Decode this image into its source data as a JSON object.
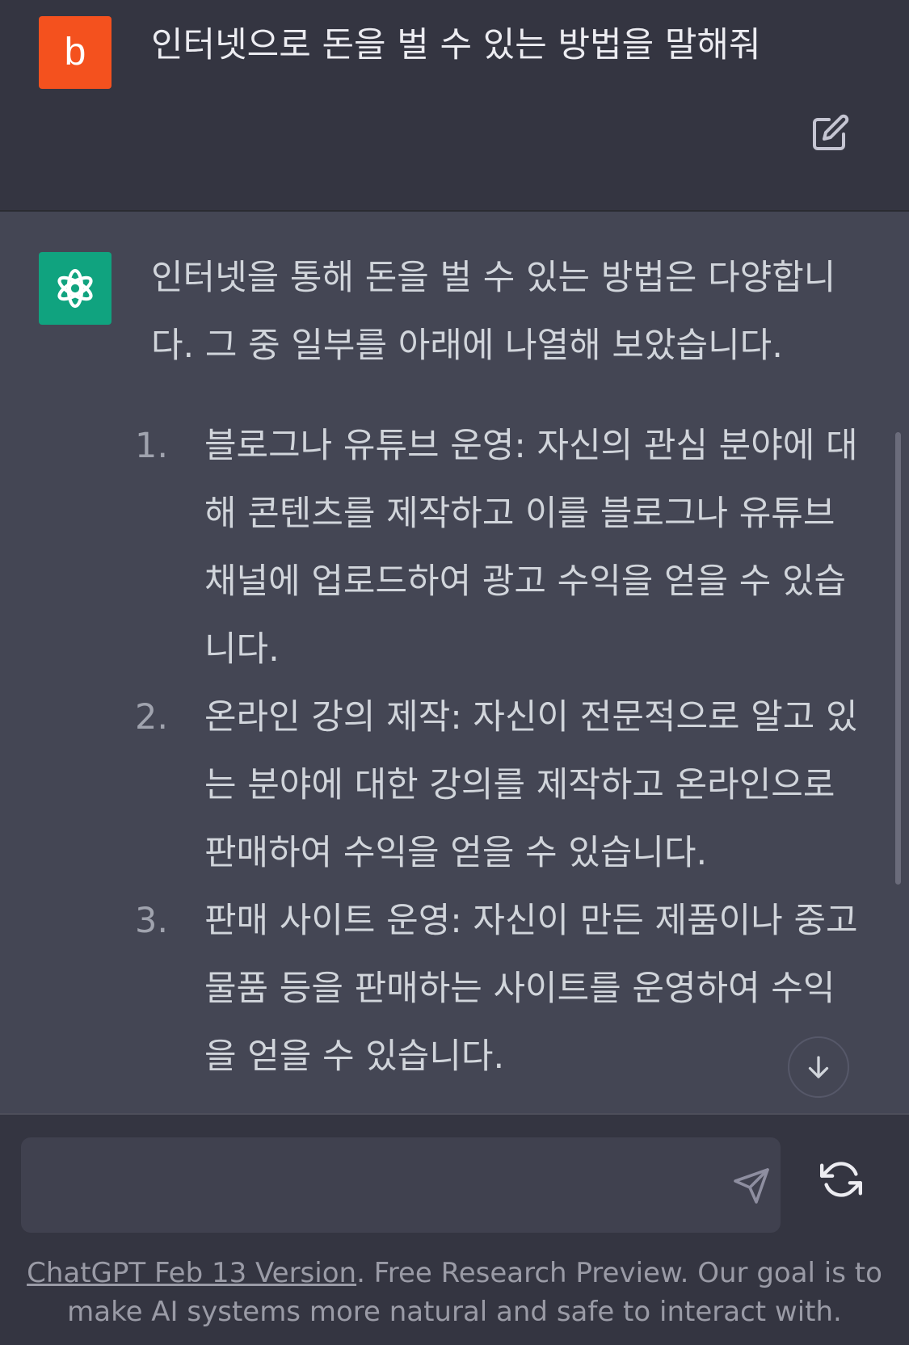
{
  "user_message": {
    "avatar_letter": "b",
    "text": "인터넷으로 돈을 벌 수 있는 방법을 말해줘"
  },
  "assistant_message": {
    "intro": "인터넷을 통해 돈을 벌 수 있는 방법은 다양합니다. 그 중 일부를 아래에 나열해 보았습니다.",
    "items": [
      {
        "number": "1.",
        "text": "블로그나 유튜브 운영: 자신의 관심 분야에 대해 콘텐츠를 제작하고 이를 블로그나 유튜브 채널에 업로드하여 광고 수익을 얻을 수 있습니다."
      },
      {
        "number": "2.",
        "text": "온라인 강의 제작: 자신이 전문적으로 알고 있는 분야에 대한 강의를 제작하고 온라인으로 판매하여 수익을 얻을 수 있습니다."
      },
      {
        "number": "3.",
        "text": "판매 사이트 운영: 자신이 만든 제품이나 중고 물품 등을 판매하는 사이트를 운영하여 수익을 얻을 수 있습니다."
      }
    ]
  },
  "composer": {
    "input_value": "",
    "input_placeholder": ""
  },
  "footer": {
    "version_link": "ChatGPT Feb 13 Version",
    "text": ". Free Research Preview. Our goal is to make AI systems more natural and safe to interact with."
  },
  "colors": {
    "user_avatar": "#f4511e",
    "assistant_avatar": "#10a37f",
    "background": "#343541",
    "assistant_background": "#444654"
  },
  "icons": {
    "edit": "edit-icon",
    "assistant_logo": "openai-logo-icon",
    "scroll_down": "arrow-down-icon",
    "send": "send-icon",
    "regenerate": "regenerate-icon"
  }
}
